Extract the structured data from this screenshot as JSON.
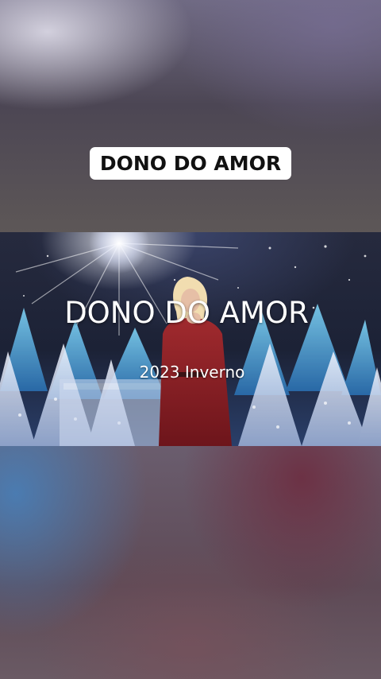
{
  "top_caption": {
    "text": "DONO DO AMOR"
  },
  "video": {
    "title": "DONO DO AMOR",
    "subtitle": "2023 Inverno"
  },
  "colors": {
    "caption_bg": "#ffffff",
    "caption_text": "#111111",
    "dress": "#8e1f24",
    "trees": "#3fa6d8"
  }
}
